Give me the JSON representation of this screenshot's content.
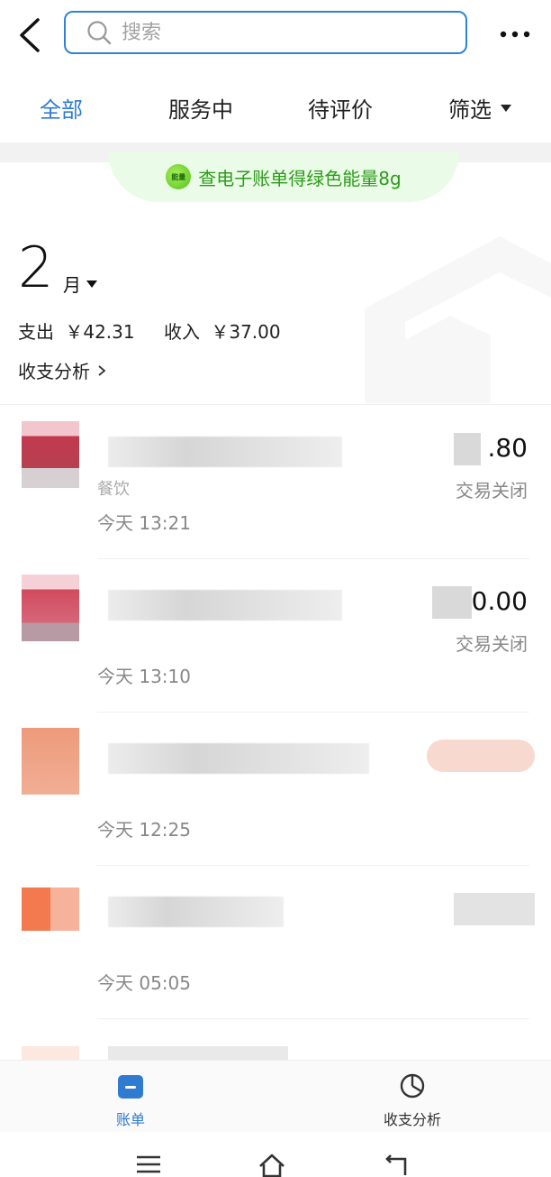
{
  "search": {
    "placeholder": "搜索"
  },
  "tabs": [
    {
      "label": "全部",
      "active": true
    },
    {
      "label": "服务中",
      "active": false
    },
    {
      "label": "待评价",
      "active": false
    },
    {
      "label": "筛选",
      "active": false
    }
  ],
  "promo": {
    "badge": "能量",
    "text": "查电子账单得绿色能量8g"
  },
  "month": {
    "number": "2",
    "unit": "月"
  },
  "summary": {
    "expense_label": "支出",
    "expense_value": "￥42.31",
    "income_label": "收入",
    "income_value": "￥37.00",
    "analysis_link": "收支分析"
  },
  "transactions": [
    {
      "category": "餐饮",
      "time": "今天  13:21",
      "amount": ".80",
      "status": "交易关闭",
      "thumb_color": "#c23a4f"
    },
    {
      "category": "",
      "time": "今天  13:10",
      "amount": "0.00",
      "status": "交易关闭",
      "thumb_color": "#d24a5e"
    },
    {
      "category": "",
      "time": "今天  12:25",
      "amount": "",
      "status": "",
      "thumb_color": "#ee9a7b"
    },
    {
      "category": "",
      "time": "今天  05:05",
      "amount": "",
      "status": "",
      "thumb_color": "#f37a4f"
    }
  ],
  "bottom_nav": {
    "bill_label": "账单",
    "analysis_label": "收支分析"
  },
  "colors": {
    "accent": "#2f7bd2",
    "promo_green": "#2c9c19"
  }
}
